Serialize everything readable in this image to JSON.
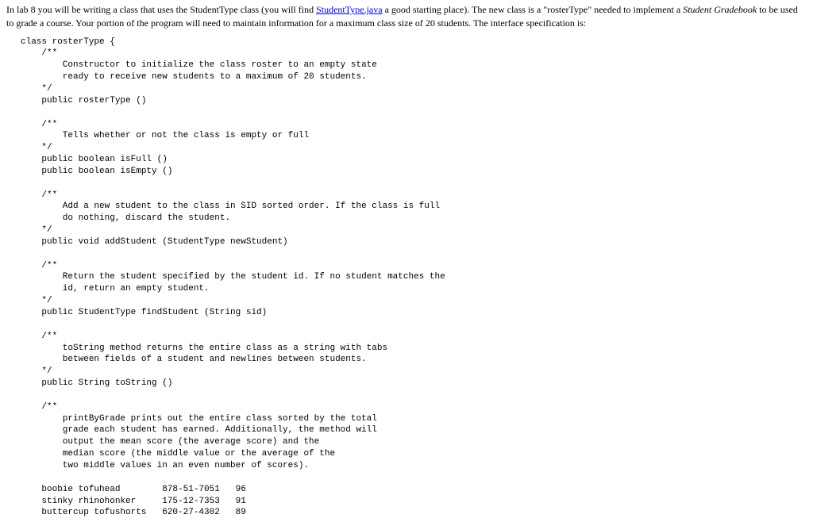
{
  "intro": {
    "part1": "In lab 8 you will be writing a class that uses the StudentType class (you will find ",
    "link_text": "StudentType.java",
    "part2": " a good starting place). The new class is a \"rosterType\" needed to implement a ",
    "italic_text": "Student Gradebook",
    "part3": " to be used to grade a course. Your portion of the program will need to maintain information for a maximum class size of 20 students. The interface specification is:"
  },
  "code": {
    "line01": "class rosterType {",
    "line02": "    /**",
    "line03": "        Constructor to initialize the class roster to an empty state",
    "line04": "        ready to receive new students to a maximum of 20 students.",
    "line05": "    */",
    "line06": "    public rosterType ()",
    "line07": "",
    "line08": "    /**",
    "line09": "        Tells whether or not the class is empty or full",
    "line10": "    */",
    "line11": "    public boolean isFull ()",
    "line12": "    public boolean isEmpty ()",
    "line13": "",
    "line14": "    /**",
    "line15": "        Add a new student to the class in SID sorted order. If the class is full",
    "line16": "        do nothing, discard the student.",
    "line17": "    */",
    "line18": "    public void addStudent (StudentType newStudent)",
    "line19": "",
    "line20": "    /**",
    "line21": "        Return the student specified by the student id. If no student matches the",
    "line22": "        id, return an empty student.",
    "line23": "    */",
    "line24": "    public StudentType findStudent (String sid)",
    "line25": "",
    "line26": "    /**",
    "line27": "        toString method returns the entire class as a string with tabs",
    "line28": "        between fields of a student and newlines between students.",
    "line29": "    */",
    "line30": "    public String toString ()",
    "line31": "",
    "line32": "    /**",
    "line33": "        printByGrade prints out the entire class sorted by the total",
    "line34": "        grade each student has earned. Additionally, the method will",
    "line35": "        output the mean score (the average score) and the",
    "line36": "        median score (the middle value or the average of the",
    "line37": "        two middle values in an even number of scores).",
    "line38": "",
    "line39": "    boobie tofuhead        878-51-7051   96",
    "line40": "    stinky rhinohonker     175-12-7353   91",
    "line41": "    buttercup tofushorts   620-27-4302   89"
  }
}
